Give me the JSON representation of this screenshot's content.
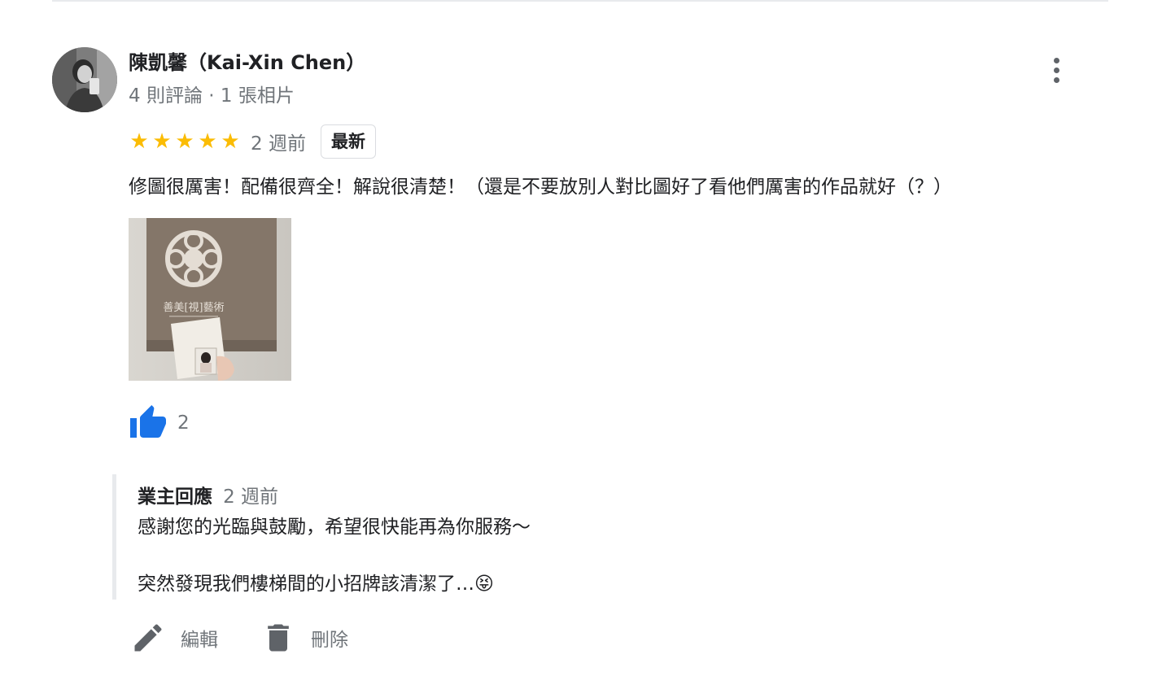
{
  "reviewer": {
    "name": "陳凱馨（Kai-Xin Chen）",
    "meta": "4 則評論 · 1 張相片"
  },
  "review": {
    "rating": 5,
    "rating_max": 5,
    "stars": "★★★★★",
    "time": "2 週前",
    "badge": "最新",
    "text": "修圖很厲害！配備很齊全！解說很清楚！（還是不要放別人對比圖好了看他們厲害的作品就好（？）",
    "photo_caption": "善美[視]藝術",
    "likes": "2"
  },
  "owner_reply": {
    "title": "業主回應",
    "time": "2 週前",
    "line1": "感謝您的光臨與鼓勵，希望很快能再為你服務～",
    "line2": "突然發現我們樓梯間的小招牌該清潔了…😝"
  },
  "actions": {
    "edit_label": "編輯",
    "delete_label": "刪除"
  },
  "colors": {
    "star": "#fbbc04",
    "like": "#1a73e8",
    "secondary_text": "#70757a",
    "icon": "#5f6368"
  }
}
